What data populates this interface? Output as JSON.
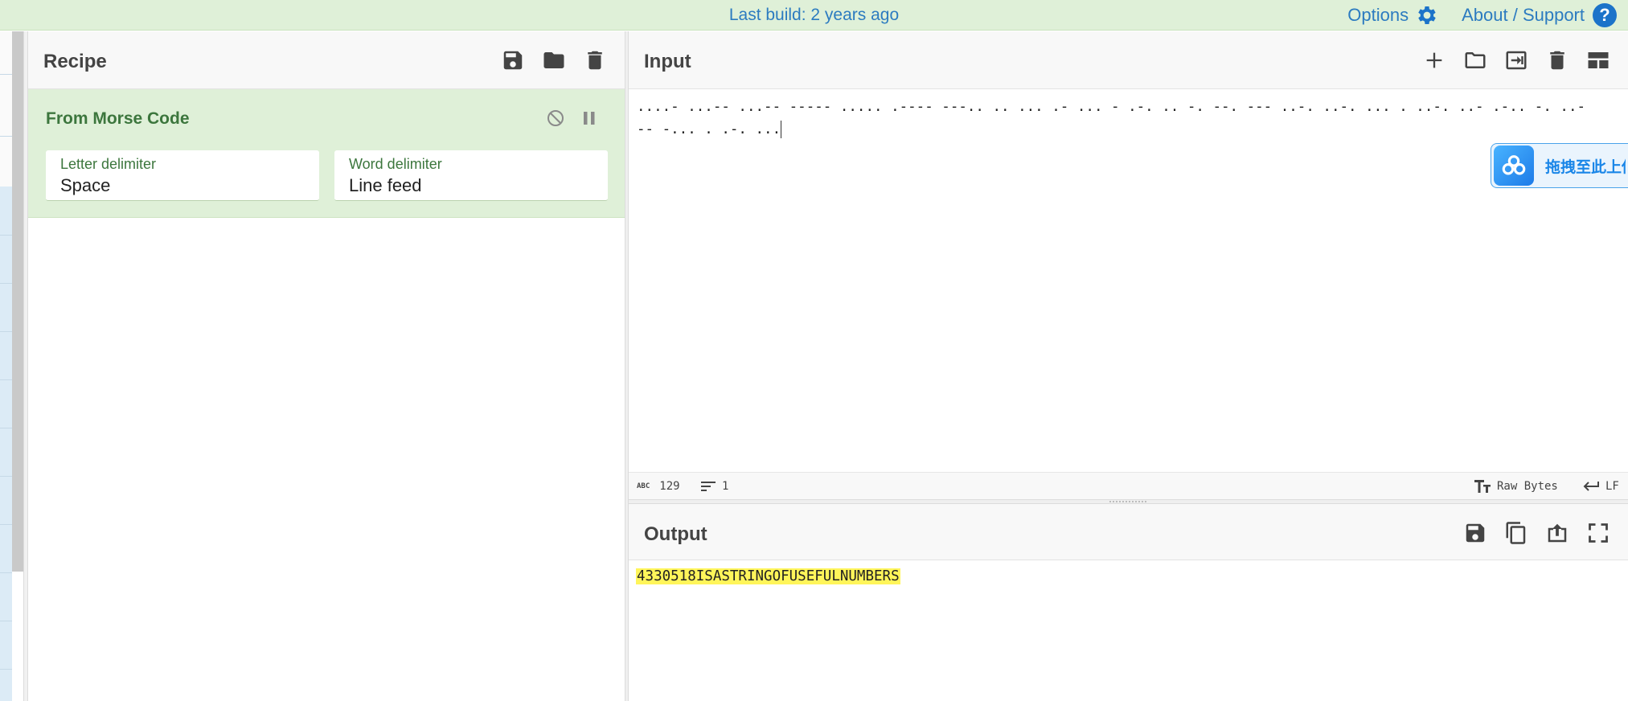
{
  "banner": {
    "build_text": "Last build: 2 years ago",
    "options_label": "Options",
    "about_label": "About / Support",
    "help_glyph": "?"
  },
  "recipe": {
    "title": "Recipe",
    "icons": [
      "save-icon",
      "folder-icon",
      "trash-icon"
    ],
    "operation": {
      "title": "From Morse Code",
      "controls": [
        "disable-icon",
        "pause-icon"
      ],
      "letter_delimiter_label": "Letter delimiter",
      "letter_delimiter_value": "Space",
      "word_delimiter_label": "Word delimiter",
      "word_delimiter_value": "Line feed"
    }
  },
  "input": {
    "title": "Input",
    "icons": [
      "add-icon",
      "folder-icon",
      "import-icon",
      "trash-icon",
      "layout-icon"
    ],
    "text": "....- ...-- ...-- ----- ..... .---- ---.. .. ... .- ... - .-. .. -. --. --- ..-. ..-. ... . ..-. ..- .-.. -. ..- -- -... . .-. ...",
    "baidu_text": "拖拽至此上传",
    "status": {
      "char_icon_text": "ABC",
      "char_count": "129",
      "line_count": "1",
      "encoding": "Raw Bytes",
      "eol": "LF"
    }
  },
  "output": {
    "title": "Output",
    "icons": [
      "save-icon",
      "copy-icon",
      "replace-input-icon",
      "maximize-icon"
    ],
    "text": "4330518ISASTRINGOFUSEFULNUMBERS"
  },
  "colors": {
    "banner_bg": "#dff0d8",
    "link_blue": "#2c7bc0",
    "op_bg": "#dff0d8",
    "op_text": "#3c763d",
    "highlight": "#fff55a"
  }
}
